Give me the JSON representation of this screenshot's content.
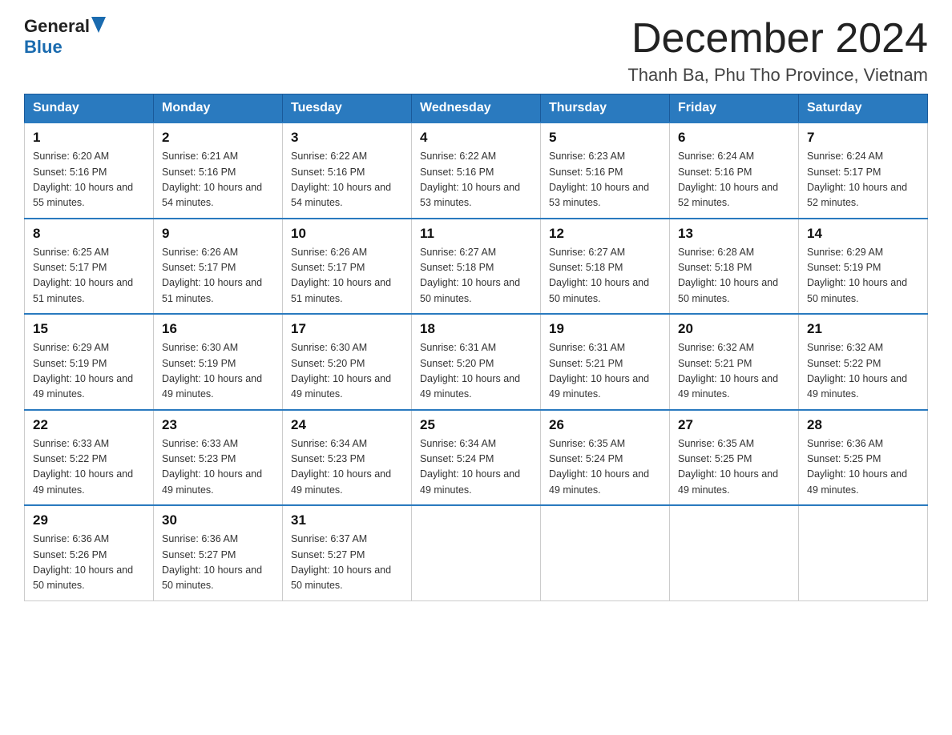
{
  "header": {
    "logo_general": "General",
    "logo_blue": "Blue",
    "month_title": "December 2024",
    "location": "Thanh Ba, Phu Tho Province, Vietnam"
  },
  "weekdays": [
    "Sunday",
    "Monday",
    "Tuesday",
    "Wednesday",
    "Thursday",
    "Friday",
    "Saturday"
  ],
  "weeks": [
    [
      {
        "day": "1",
        "sunrise": "6:20 AM",
        "sunset": "5:16 PM",
        "daylight": "10 hours and 55 minutes."
      },
      {
        "day": "2",
        "sunrise": "6:21 AM",
        "sunset": "5:16 PM",
        "daylight": "10 hours and 54 minutes."
      },
      {
        "day": "3",
        "sunrise": "6:22 AM",
        "sunset": "5:16 PM",
        "daylight": "10 hours and 54 minutes."
      },
      {
        "day": "4",
        "sunrise": "6:22 AM",
        "sunset": "5:16 PM",
        "daylight": "10 hours and 53 minutes."
      },
      {
        "day": "5",
        "sunrise": "6:23 AM",
        "sunset": "5:16 PM",
        "daylight": "10 hours and 53 minutes."
      },
      {
        "day": "6",
        "sunrise": "6:24 AM",
        "sunset": "5:16 PM",
        "daylight": "10 hours and 52 minutes."
      },
      {
        "day": "7",
        "sunrise": "6:24 AM",
        "sunset": "5:17 PM",
        "daylight": "10 hours and 52 minutes."
      }
    ],
    [
      {
        "day": "8",
        "sunrise": "6:25 AM",
        "sunset": "5:17 PM",
        "daylight": "10 hours and 51 minutes."
      },
      {
        "day": "9",
        "sunrise": "6:26 AM",
        "sunset": "5:17 PM",
        "daylight": "10 hours and 51 minutes."
      },
      {
        "day": "10",
        "sunrise": "6:26 AM",
        "sunset": "5:17 PM",
        "daylight": "10 hours and 51 minutes."
      },
      {
        "day": "11",
        "sunrise": "6:27 AM",
        "sunset": "5:18 PM",
        "daylight": "10 hours and 50 minutes."
      },
      {
        "day": "12",
        "sunrise": "6:27 AM",
        "sunset": "5:18 PM",
        "daylight": "10 hours and 50 minutes."
      },
      {
        "day": "13",
        "sunrise": "6:28 AM",
        "sunset": "5:18 PM",
        "daylight": "10 hours and 50 minutes."
      },
      {
        "day": "14",
        "sunrise": "6:29 AM",
        "sunset": "5:19 PM",
        "daylight": "10 hours and 50 minutes."
      }
    ],
    [
      {
        "day": "15",
        "sunrise": "6:29 AM",
        "sunset": "5:19 PM",
        "daylight": "10 hours and 49 minutes."
      },
      {
        "day": "16",
        "sunrise": "6:30 AM",
        "sunset": "5:19 PM",
        "daylight": "10 hours and 49 minutes."
      },
      {
        "day": "17",
        "sunrise": "6:30 AM",
        "sunset": "5:20 PM",
        "daylight": "10 hours and 49 minutes."
      },
      {
        "day": "18",
        "sunrise": "6:31 AM",
        "sunset": "5:20 PM",
        "daylight": "10 hours and 49 minutes."
      },
      {
        "day": "19",
        "sunrise": "6:31 AM",
        "sunset": "5:21 PM",
        "daylight": "10 hours and 49 minutes."
      },
      {
        "day": "20",
        "sunrise": "6:32 AM",
        "sunset": "5:21 PM",
        "daylight": "10 hours and 49 minutes."
      },
      {
        "day": "21",
        "sunrise": "6:32 AM",
        "sunset": "5:22 PM",
        "daylight": "10 hours and 49 minutes."
      }
    ],
    [
      {
        "day": "22",
        "sunrise": "6:33 AM",
        "sunset": "5:22 PM",
        "daylight": "10 hours and 49 minutes."
      },
      {
        "day": "23",
        "sunrise": "6:33 AM",
        "sunset": "5:23 PM",
        "daylight": "10 hours and 49 minutes."
      },
      {
        "day": "24",
        "sunrise": "6:34 AM",
        "sunset": "5:23 PM",
        "daylight": "10 hours and 49 minutes."
      },
      {
        "day": "25",
        "sunrise": "6:34 AM",
        "sunset": "5:24 PM",
        "daylight": "10 hours and 49 minutes."
      },
      {
        "day": "26",
        "sunrise": "6:35 AM",
        "sunset": "5:24 PM",
        "daylight": "10 hours and 49 minutes."
      },
      {
        "day": "27",
        "sunrise": "6:35 AM",
        "sunset": "5:25 PM",
        "daylight": "10 hours and 49 minutes."
      },
      {
        "day": "28",
        "sunrise": "6:36 AM",
        "sunset": "5:25 PM",
        "daylight": "10 hours and 49 minutes."
      }
    ],
    [
      {
        "day": "29",
        "sunrise": "6:36 AM",
        "sunset": "5:26 PM",
        "daylight": "10 hours and 50 minutes."
      },
      {
        "day": "30",
        "sunrise": "6:36 AM",
        "sunset": "5:27 PM",
        "daylight": "10 hours and 50 minutes."
      },
      {
        "day": "31",
        "sunrise": "6:37 AM",
        "sunset": "5:27 PM",
        "daylight": "10 hours and 50 minutes."
      },
      null,
      null,
      null,
      null
    ]
  ]
}
